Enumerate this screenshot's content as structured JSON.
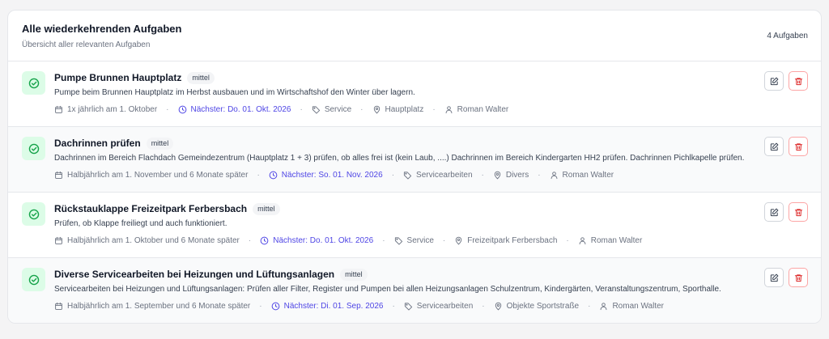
{
  "header": {
    "title": "Alle wiederkehrenden Aufgaben",
    "subtitle": "Übersicht aller relevanten Aufgaben",
    "count": "4 Aufgaben"
  },
  "colors": {
    "status_bg": "#dcfce7",
    "status_icon": "#16a34a",
    "next_date": "#4f46e5",
    "delete": "#dc2626"
  },
  "tasks": [
    {
      "title": "Pumpe Brunnen Hauptplatz",
      "priority": "mittel",
      "description": "Pumpe beim Brunnen Hauptplatz im Herbst ausbauen und im Wirtschaftshof den Winter über lagern.",
      "schedule": "1x jährlich am 1. Oktober",
      "next": "Nächster: Do. 01. Okt. 2026",
      "category": "Service",
      "location": "Hauptplatz",
      "assignee": "Roman Walter"
    },
    {
      "title": "Dachrinnen prüfen",
      "priority": "mittel",
      "description": "Dachrinnen im Bereich Flachdach Gemeindezentrum (Hauptplatz 1 + 3) prüfen, ob alles frei ist (kein Laub, ....) Dachrinnen im Bereich Kindergarten HH2 prüfen. Dachrinnen Pichlkapelle prüfen.",
      "schedule": "Halbjährlich am 1. November und 6 Monate später",
      "next": "Nächster: So. 01. Nov. 2026",
      "category": "Servicearbeiten",
      "location": "Divers",
      "assignee": "Roman Walter"
    },
    {
      "title": "Rückstauklappe Freizeitpark Ferbersbach",
      "priority": "mittel",
      "description": "Prüfen, ob Klappe freiliegt und auch funktioniert.",
      "schedule": "Halbjährlich am 1. Oktober und 6 Monate später",
      "next": "Nächster: Do. 01. Okt. 2026",
      "category": "Service",
      "location": "Freizeitpark Ferbersbach",
      "assignee": "Roman Walter"
    },
    {
      "title": "Diverse Servicearbeiten bei Heizungen und Lüftungsanlagen",
      "priority": "mittel",
      "description": "Servicearbeiten bei Heizungen und Lüftungsanlagen: Prüfen aller Filter, Register und Pumpen bei allen Heizungsanlagen Schulzentrum, Kindergärten, Veranstaltungszentrum, Sporthalle.",
      "schedule": "Halbjährlich am 1. September und 6 Monate später",
      "next": "Nächster: Di. 01. Sep. 2026",
      "category": "Servicearbeiten",
      "location": "Objekte Sportstraße",
      "assignee": "Roman Walter"
    }
  ]
}
